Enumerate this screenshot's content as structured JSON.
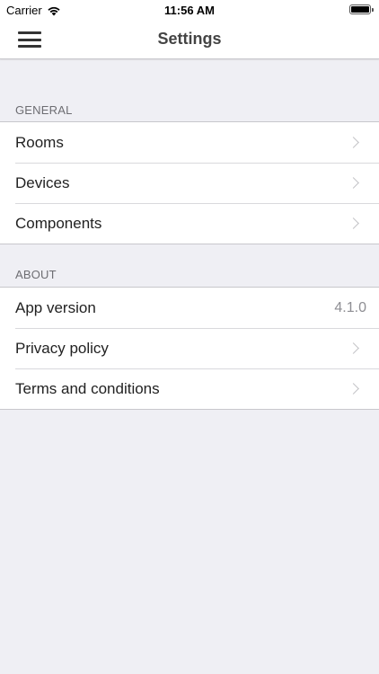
{
  "status_bar": {
    "carrier": "Carrier",
    "time": "11:56 AM",
    "wifi_icon": "wifi-icon",
    "battery_icon": "battery-icon"
  },
  "nav": {
    "title": "Settings",
    "menu_icon": "hamburger-menu-icon"
  },
  "sections": {
    "general": {
      "header": "GENERAL",
      "items": [
        {
          "label": "Rooms"
        },
        {
          "label": "Devices"
        },
        {
          "label": "Components"
        }
      ]
    },
    "about": {
      "header": "ABOUT",
      "items": [
        {
          "label": "App version",
          "value": "4.1.0"
        },
        {
          "label": "Privacy policy"
        },
        {
          "label": "Terms and conditions"
        }
      ]
    }
  },
  "colors": {
    "background": "#efeff4",
    "cell": "#ffffff",
    "separator": "#c8c7cc",
    "secondary_text": "#8e8e93"
  }
}
